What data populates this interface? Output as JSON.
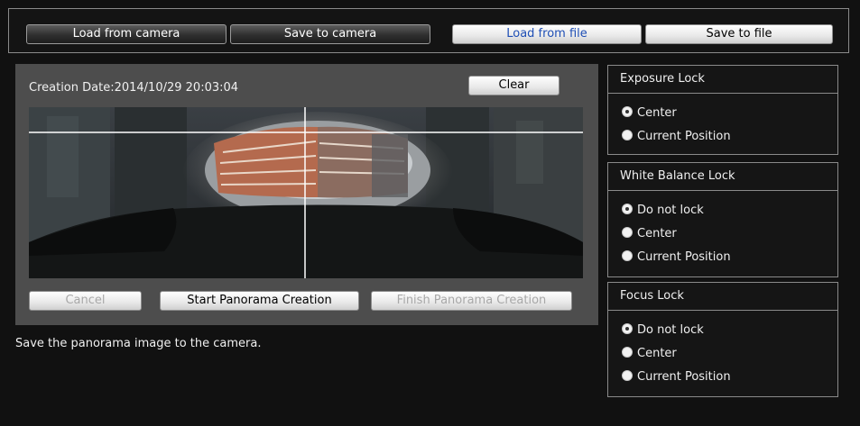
{
  "toolbar": {
    "load_camera": "Load from camera",
    "save_camera": "Save to camera",
    "load_file": "Load from file",
    "save_file": "Save to file"
  },
  "panorama": {
    "creation_date": "Creation Date:2014/10/29 20:03:04",
    "clear": "Clear",
    "cancel": "Cancel",
    "start": "Start Panorama Creation",
    "finish": "Finish Panorama Creation"
  },
  "status_message": "Save the panorama image to the camera.",
  "exposure_lock": {
    "title": "Exposure Lock",
    "options": [
      "Center",
      "Current Position"
    ]
  },
  "white_balance_lock": {
    "title": "White Balance Lock",
    "options": [
      "Do not lock",
      "Center",
      "Current Position"
    ]
  },
  "focus_lock": {
    "title": "Focus Lock",
    "options": [
      "Do not lock",
      "Center",
      "Current Position"
    ]
  }
}
